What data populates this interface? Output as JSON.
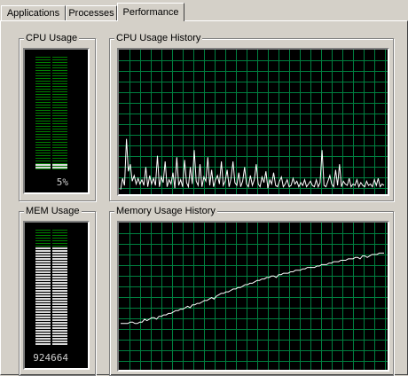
{
  "tabs": [
    {
      "label": "Applications",
      "active": false
    },
    {
      "label": "Processes",
      "active": false
    },
    {
      "label": "Performance",
      "active": true
    }
  ],
  "groups": {
    "cpu_usage": {
      "title": "CPU Usage",
      "value": "5%",
      "level_fraction": 0.05
    },
    "cpu_history": {
      "title": "CPU Usage History"
    },
    "mem_usage": {
      "title": "MEM Usage",
      "value": "924664",
      "level_fraction": 0.85
    },
    "mem_history": {
      "title": "Memory Usage History"
    }
  },
  "colors": {
    "window_bg": "#d4d0c8",
    "screen_bg": "#000000",
    "grid": "#008040",
    "trace": "#ffffff",
    "meter_unlit": "#008000",
    "meter_lit": "#d8d8d8"
  },
  "chart_data": [
    {
      "type": "line",
      "title": "CPU Usage History",
      "ylim": [
        0,
        100
      ],
      "grid": true,
      "series": [
        {
          "values": [
            2,
            10,
            5,
            38,
            15,
            20,
            8,
            12,
            6,
            10,
            6,
            9,
            5,
            18,
            4,
            12,
            6,
            10,
            5,
            26,
            4,
            11,
            7,
            22,
            4,
            9,
            6,
            14,
            3,
            25,
            5,
            9,
            4,
            23,
            7,
            4,
            18,
            6,
            30,
            8,
            5,
            20,
            4,
            11,
            8,
            25,
            5,
            16,
            4,
            9,
            12,
            6,
            22,
            5,
            8,
            16,
            4,
            10,
            22,
            7,
            5,
            14,
            4,
            8,
            18,
            6,
            4,
            12,
            5,
            9,
            20,
            6,
            4,
            11,
            7,
            15,
            3,
            9,
            6,
            14,
            5,
            4,
            8,
            11,
            4,
            6,
            9,
            4,
            5,
            10,
            6,
            8,
            4,
            7,
            5,
            9,
            4,
            6,
            8,
            5,
            4,
            9,
            4,
            7,
            30,
            5,
            4,
            8,
            12,
            6,
            4,
            16,
            5,
            20,
            4,
            8,
            6,
            5,
            10,
            4,
            6,
            5,
            9,
            4,
            7,
            5,
            4,
            8,
            5,
            6,
            4,
            9,
            5,
            10,
            4,
            6,
            5
          ]
        }
      ]
    },
    {
      "type": "line",
      "title": "Memory Usage History",
      "ylim": [
        0,
        100
      ],
      "grid": true,
      "series": [
        {
          "values": [
            31,
            31,
            31,
            31,
            32,
            32,
            31,
            31,
            32,
            32,
            34,
            33,
            34,
            35,
            35,
            34,
            36,
            36,
            37,
            37,
            38,
            38,
            39,
            40,
            40,
            41,
            41,
            42,
            43,
            42,
            44,
            44,
            45,
            45,
            46,
            47,
            47,
            48,
            49,
            48,
            50,
            51,
            52,
            52,
            53,
            53,
            54,
            55,
            55,
            56,
            56,
            57,
            58,
            58,
            59,
            59,
            60,
            61,
            61,
            62,
            62,
            63,
            63,
            64,
            64,
            63,
            65,
            65,
            66,
            66,
            66,
            67,
            67,
            68,
            68,
            68,
            69,
            69,
            70,
            70,
            70,
            70,
            71,
            71,
            72,
            72,
            72,
            73,
            73,
            74,
            74,
            74,
            75,
            75,
            75,
            76,
            76,
            76,
            77,
            77,
            76,
            78,
            78,
            77,
            78,
            79,
            79,
            79,
            80,
            80,
            80
          ]
        }
      ]
    }
  ]
}
